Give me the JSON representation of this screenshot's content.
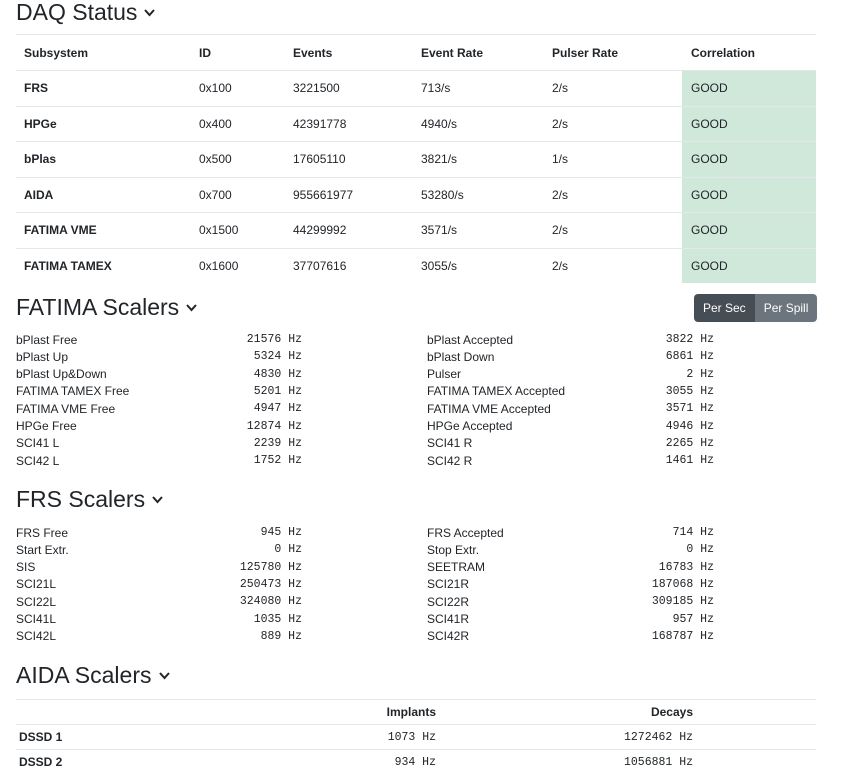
{
  "daq": {
    "title": "DAQ Status",
    "headers": [
      "Subsystem",
      "ID",
      "Events",
      "Event Rate",
      "Pulser Rate",
      "Correlation"
    ],
    "rows": [
      {
        "subsystem": "FRS",
        "id": "0x100",
        "events": "3221500",
        "event_rate": "713/s",
        "pulser_rate": "2/s",
        "correlation": "GOOD"
      },
      {
        "subsystem": "HPGe",
        "id": "0x400",
        "events": "42391778",
        "event_rate": "4940/s",
        "pulser_rate": "2/s",
        "correlation": "GOOD"
      },
      {
        "subsystem": "bPlas",
        "id": "0x500",
        "events": "17605110",
        "event_rate": "3821/s",
        "pulser_rate": "1/s",
        "correlation": "GOOD"
      },
      {
        "subsystem": "AIDA",
        "id": "0x700",
        "events": "955661977",
        "event_rate": "53280/s",
        "pulser_rate": "2/s",
        "correlation": "GOOD"
      },
      {
        "subsystem": "FATIMA VME",
        "id": "0x1500",
        "events": "44299992",
        "event_rate": "3571/s",
        "pulser_rate": "2/s",
        "correlation": "GOOD"
      },
      {
        "subsystem": "FATIMA TAMEX",
        "id": "0x1600",
        "events": "37707616",
        "event_rate": "3055/s",
        "pulser_rate": "2/s",
        "correlation": "GOOD"
      }
    ]
  },
  "fatima": {
    "title": "FATIMA Scalers",
    "toggle": {
      "per_sec": "Per Sec",
      "per_spill": "Per Spill",
      "active": "Per Sec"
    },
    "left": [
      {
        "name": "bPlast Free",
        "value": "21576 Hz"
      },
      {
        "name": "bPlast Up",
        "value": "5324 Hz"
      },
      {
        "name": "bPlast Up&Down",
        "value": "4830 Hz"
      },
      {
        "name": "FATIMA TAMEX Free",
        "value": "5201 Hz"
      },
      {
        "name": "FATIMA VME Free",
        "value": "4947 Hz"
      },
      {
        "name": "HPGe Free",
        "value": "12874 Hz"
      },
      {
        "name": "SCI41 L",
        "value": "2239 Hz"
      },
      {
        "name": "SCI42 L",
        "value": "1752 Hz"
      }
    ],
    "right": [
      {
        "name": "bPlast Accepted",
        "value": "3822 Hz"
      },
      {
        "name": "bPlast Down",
        "value": "6861 Hz"
      },
      {
        "name": "Pulser",
        "value": "2 Hz"
      },
      {
        "name": "FATIMA TAMEX Accepted",
        "value": "3055 Hz"
      },
      {
        "name": "FATIMA VME Accepted",
        "value": "3571 Hz"
      },
      {
        "name": "HPGe Accepted",
        "value": "4946 Hz"
      },
      {
        "name": "SCI41 R",
        "value": "2265 Hz"
      },
      {
        "name": "SCI42 R",
        "value": "1461 Hz"
      }
    ]
  },
  "frs": {
    "title": "FRS Scalers",
    "left": [
      {
        "name": "FRS Free",
        "value": "945 Hz"
      },
      {
        "name": "Start Extr.",
        "value": "0 Hz"
      },
      {
        "name": "SIS",
        "value": "125780 Hz"
      },
      {
        "name": "SCI21L",
        "value": "250473 Hz"
      },
      {
        "name": "SCI22L",
        "value": "324080 Hz"
      },
      {
        "name": "SCI41L",
        "value": "1035 Hz"
      },
      {
        "name": "SCI42L",
        "value": "889 Hz"
      }
    ],
    "right": [
      {
        "name": "FRS Accepted",
        "value": "714 Hz"
      },
      {
        "name": "Stop Extr.",
        "value": "0 Hz"
      },
      {
        "name": "SEETRAM",
        "value": "16783 Hz"
      },
      {
        "name": "SCI21R",
        "value": "187068 Hz"
      },
      {
        "name": "SCI22R",
        "value": "309185 Hz"
      },
      {
        "name": "SCI41R",
        "value": "957 Hz"
      },
      {
        "name": "SCI42R",
        "value": "168787 Hz"
      }
    ]
  },
  "aida": {
    "title": "AIDA Scalers",
    "headers": [
      "",
      "Implants",
      "Decays"
    ],
    "rows": [
      {
        "name": "DSSD 1",
        "implants": "1073 Hz",
        "decays": "1272462 Hz"
      },
      {
        "name": "DSSD 2",
        "implants": "934 Hz",
        "decays": "1056881 Hz"
      }
    ]
  },
  "icons": {
    "collapse": "chevron-down-icon"
  },
  "colors": {
    "good_bg": "#cfe8da",
    "toggle_active": "#474d55",
    "toggle_inactive": "#6c757d"
  }
}
